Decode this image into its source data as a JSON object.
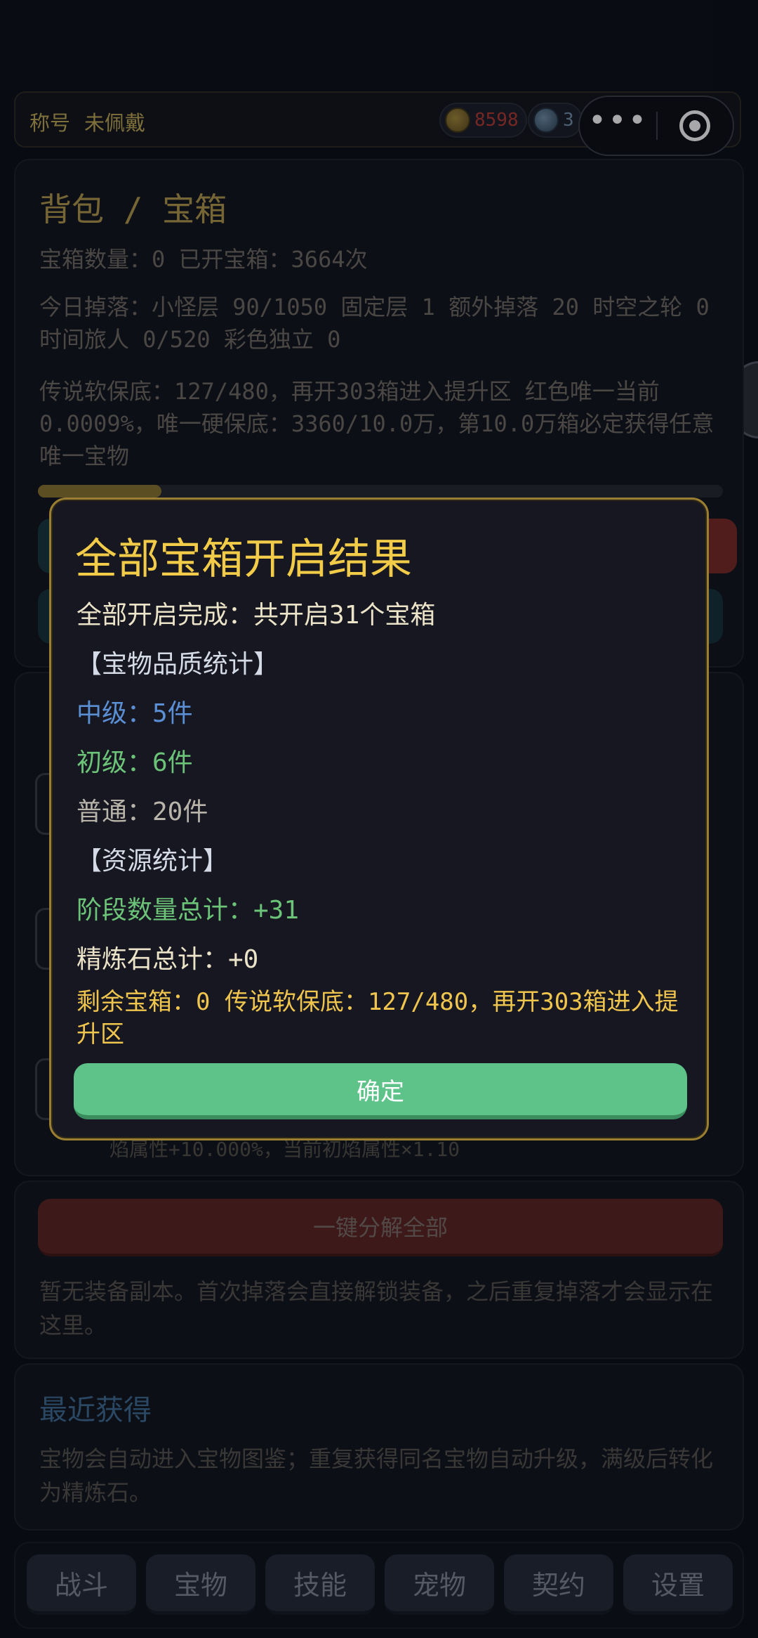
{
  "status_bar": {
    "title_label": "称号",
    "title_value": "未佩戴",
    "gold_icon": "gold-coin-icon",
    "gold_value": "8598",
    "gem_icon": "gem-icon",
    "gem_value": "3"
  },
  "capsule": {
    "more_glyph": "•••",
    "more_icon": "more-icon",
    "close_icon": "target-close-icon"
  },
  "bag_panel": {
    "title": "背包 / 宝箱",
    "line1": "宝箱数量：0  已开宝箱：3664次",
    "line2": "今日掉落：小怪层 90/1050  固定层 1  额外掉落 20  时空之轮 0  时间旅人 0/520  彩色独立 0",
    "line3": "传说软保底：127/480，再开303箱进入提升区  红色唯一当前0.0009%，唯一硬保底：3360/10.0万，第10.0万箱必定获得任意唯一宝物",
    "progress": 0.18
  },
  "mid_panel": {
    "partial_text": "焰属性+10.000%，当前初焰属性×1.10"
  },
  "decompose": {
    "button_label": "一键分解全部",
    "text": "暂无装备副本。首次掉落会直接解锁装备，之后重复掉落才会显示在这里。"
  },
  "recent": {
    "title": "最近获得",
    "text": "宝物会自动进入宝物图鉴；重复获得同名宝物自动升级，满级后转化为精炼石。"
  },
  "nav": {
    "tabs": [
      "战斗",
      "宝物",
      "技能",
      "宠物",
      "契约",
      "设置"
    ]
  },
  "modal": {
    "title": "全部宝箱开启结果",
    "summary": "全部开启完成：共开启31个宝箱",
    "quality_header": "【宝物品质统计】",
    "mid_grade": "中级：5件",
    "beginner_grade": "初级：6件",
    "normal_grade": "普通：20件",
    "resource_header": "【资源统计】",
    "stage_total": "阶段数量总计：+31",
    "refine_total": "精炼石总计：+0",
    "footer": "剩余宝箱：0  传说软保底：127/480，再开303箱进入提升区",
    "confirm_label": "确定",
    "colors": {
      "title": "#f2cc48",
      "mid": "#5b8fd4",
      "beginner": "#6cc478",
      "confirm": "#5ec389"
    }
  }
}
